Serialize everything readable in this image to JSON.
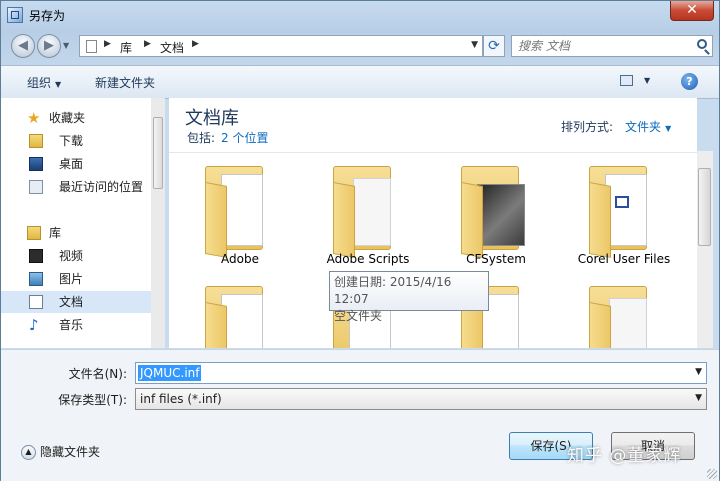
{
  "window": {
    "title": "另存为",
    "close_label": "✕"
  },
  "address": {
    "crumbs": [
      "库",
      "文档"
    ],
    "search_placeholder": "搜索 文档"
  },
  "toolbar": {
    "organize": "组织",
    "new_folder": "新建文件夹",
    "help": "?"
  },
  "nav": {
    "favorites": {
      "label": "收藏夹",
      "items": [
        "下载",
        "桌面",
        "最近访问的位置"
      ]
    },
    "libraries": {
      "label": "库",
      "items": [
        "视频",
        "图片",
        "文档",
        "音乐"
      ]
    },
    "selected": "文档"
  },
  "library": {
    "title": "文档库",
    "includes_label": "包括:",
    "includes_value": "2 个位置",
    "arrange_label": "排列方式:",
    "arrange_value": "文件夹"
  },
  "folders": [
    {
      "name": "Adobe"
    },
    {
      "name": "Adobe Scripts"
    },
    {
      "name": "CFSystem"
    },
    {
      "name": "Corel User Files"
    }
  ],
  "tooltip": {
    "line1": "创建日期: 2015/4/16 12:07",
    "line2": "空文件夹"
  },
  "form": {
    "filename_label": "文件名(N):",
    "filename_value": "JQMUC.inf",
    "filetype_label": "保存类型(T):",
    "filetype_value": "inf files (*.inf)"
  },
  "footer": {
    "hide_folders": "隐藏文件夹",
    "save": "保存(S)",
    "cancel": "取消",
    "watermark": "知乎 @董家辉"
  }
}
